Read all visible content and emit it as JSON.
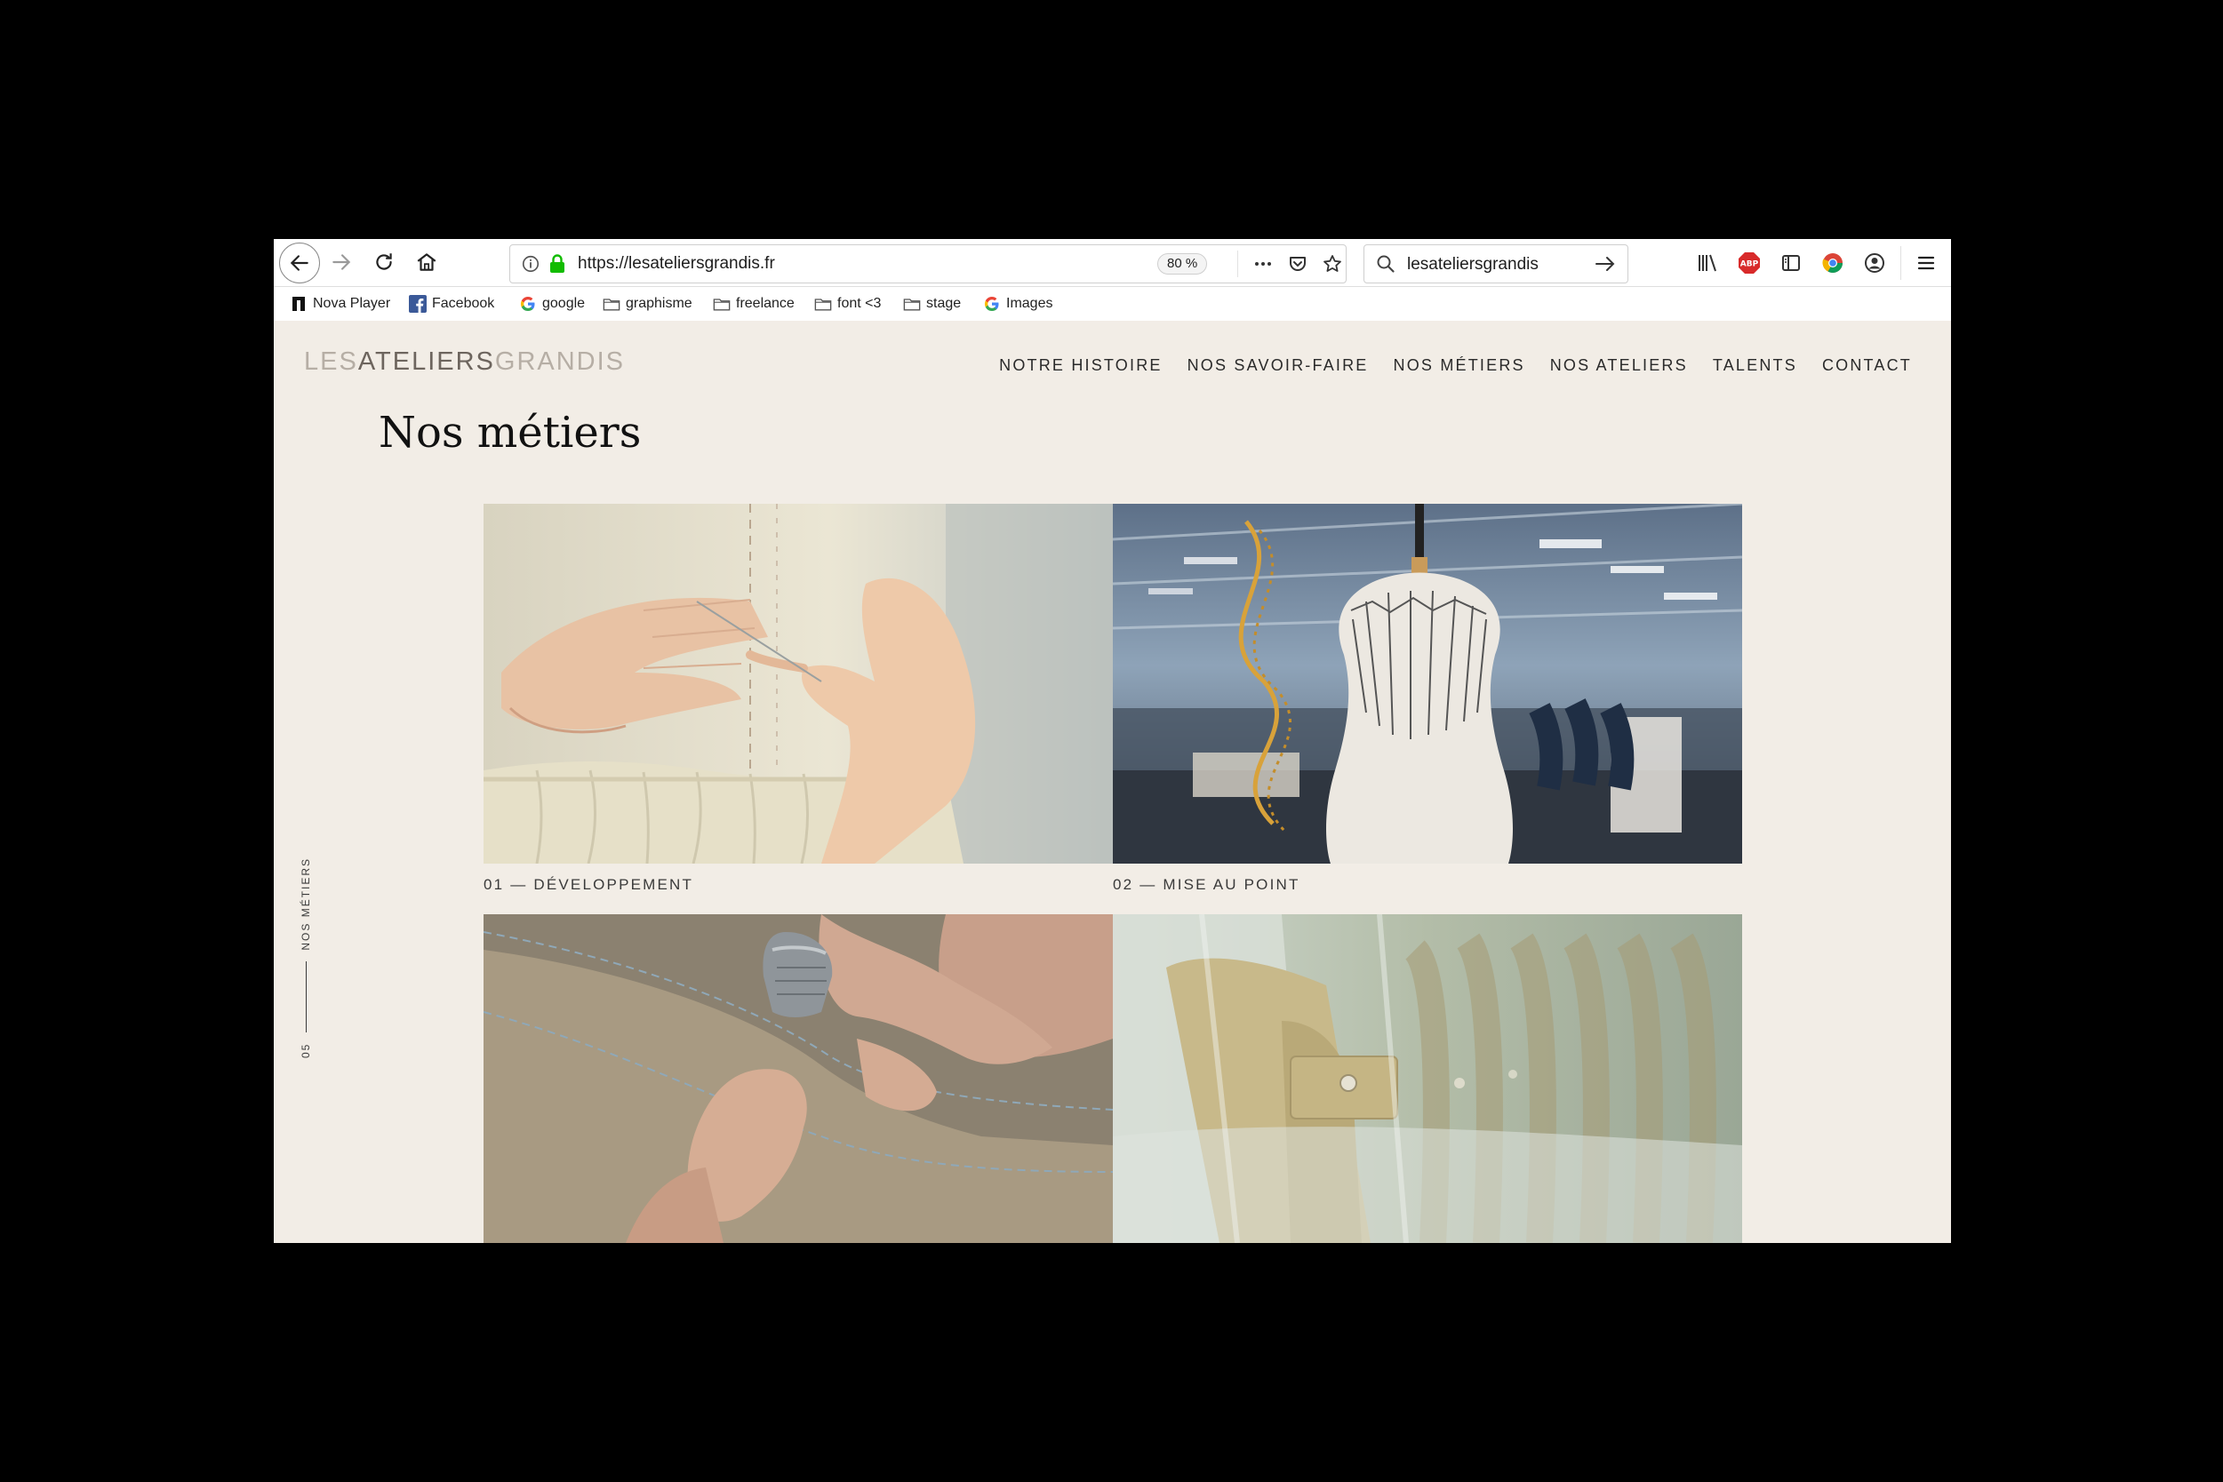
{
  "browser": {
    "url": "https://lesateliersgrandis.fr",
    "zoom": "80 %",
    "search_query": "lesateliersgrandis",
    "bookmarks": [
      {
        "label": "Nova Player",
        "icon": "nova-icon"
      },
      {
        "label": "Facebook",
        "icon": "facebook-icon"
      },
      {
        "label": "google",
        "icon": "google-icon"
      },
      {
        "label": "graphisme",
        "icon": "folder-icon"
      },
      {
        "label": "freelance",
        "icon": "folder-icon"
      },
      {
        "label": "font <3",
        "icon": "folder-icon"
      },
      {
        "label": "stage",
        "icon": "folder-icon"
      },
      {
        "label": "Images",
        "icon": "google-icon"
      }
    ]
  },
  "site": {
    "logo": {
      "part1": "LES",
      "part2": "ATELIERS",
      "part3": "GRANDIS"
    },
    "nav": [
      "NOTRE HISTOIRE",
      "NOS SAVOIR-FAIRE",
      "NOS MÉTIERS",
      "NOS ATELIERS",
      "TALENTS",
      "CONTACT"
    ],
    "page_title": "Nos métiers",
    "side_label": {
      "text": "NOS MÉTIERS",
      "number": "05"
    },
    "tiles": [
      {
        "caption": "01 — DÉVELOPPEMENT",
        "image": "hands-sewing-cream-fabric"
      },
      {
        "caption": "02 — MISE AU POINT",
        "image": "dress-form-in-workshop"
      },
      {
        "caption": "",
        "image": "thimble-hand-stitching"
      },
      {
        "caption": "",
        "image": "garments-in-plastic-covers"
      }
    ]
  },
  "colors": {
    "page_bg": "#f2ede6",
    "frame_bg": "#000000",
    "text_dark": "#111111",
    "logo_light": "#b6aea5",
    "logo_dark": "#6d655e"
  }
}
